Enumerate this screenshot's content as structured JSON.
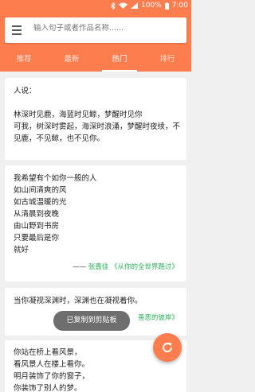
{
  "status": {
    "battery": "100%",
    "time": "7:00"
  },
  "search": {
    "placeholder": "输入句子或者作品名称......"
  },
  "tabs": [
    {
      "label": "推荐"
    },
    {
      "label": "最新"
    },
    {
      "label": "热门"
    },
    {
      "label": "排行"
    }
  ],
  "active_tab": "热门",
  "cards": [
    {
      "text": "人说：\n\n林深时见鹿，海蓝时见鲸，梦醒时见你\n可我，树深时雾起，海深时浪涌，梦醒时夜续，不见鹿，不见鲸，也不见你。"
    },
    {
      "text": "我希望有个如你一般的人\n如山间清爽的风\n如古城温暖的光\n从清晨到夜晚\n由山野到书房\n只要最后是你\n就好",
      "dash": "——",
      "author": "张嘉佳",
      "work": "《从你的全世界路过》"
    },
    {
      "text": "当你凝视深渊时，深渊也在凝视着你。",
      "work_fragment": "善恶的彼岸》"
    },
    {
      "text": "你站在桥上看风景，\n看风景人在楼上看你。\n明月装饰了你的窗子，\n你装饰了别人的梦。"
    }
  ],
  "toast": {
    "message": "已复制到剪贴板"
  },
  "fab": {
    "icon": "refresh-icon"
  },
  "colors": {
    "accent": "#fe7d4f",
    "link": "#2eaf5c"
  }
}
